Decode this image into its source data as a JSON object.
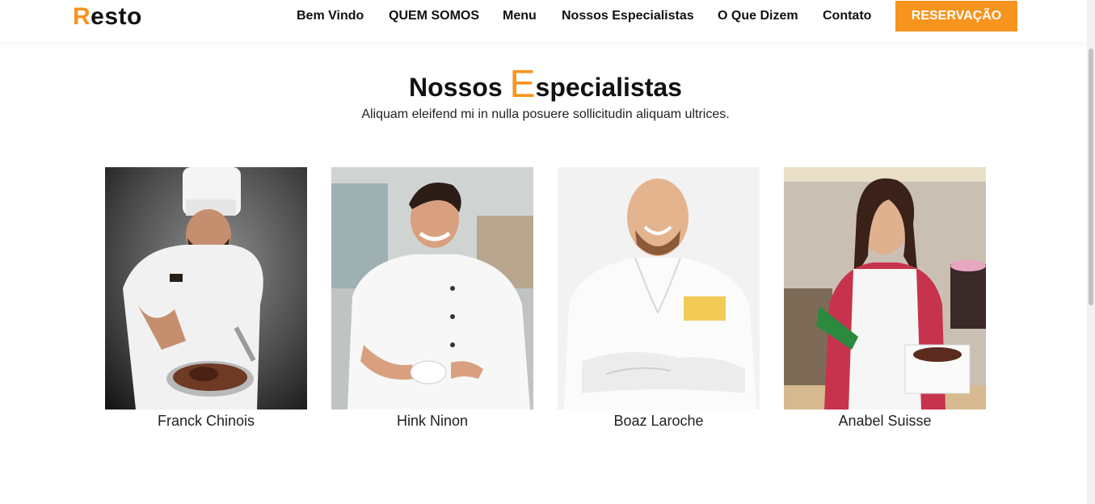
{
  "brand": {
    "first_letter": "R",
    "rest": "esto"
  },
  "nav": {
    "items": [
      "Bem Vindo",
      "QUEM SOMOS",
      "Menu",
      "Nossos Especialistas",
      "O Que Dizem",
      "Contato"
    ],
    "cta": "RESERVAÇÃO"
  },
  "section": {
    "title_start": "Nossos ",
    "title_letter": "E",
    "title_rest": "specialistas",
    "subtitle": "Aliquam eleifend mi in nulla posuere sollicitudin aliquam ultrices."
  },
  "specialists": [
    {
      "name": "Franck Chinois"
    },
    {
      "name": "Hink Ninon"
    },
    {
      "name": "Boaz Laroche"
    },
    {
      "name": "Anabel Suisse"
    }
  ],
  "colors": {
    "accent": "#f7931e",
    "button": "#f7941d"
  }
}
